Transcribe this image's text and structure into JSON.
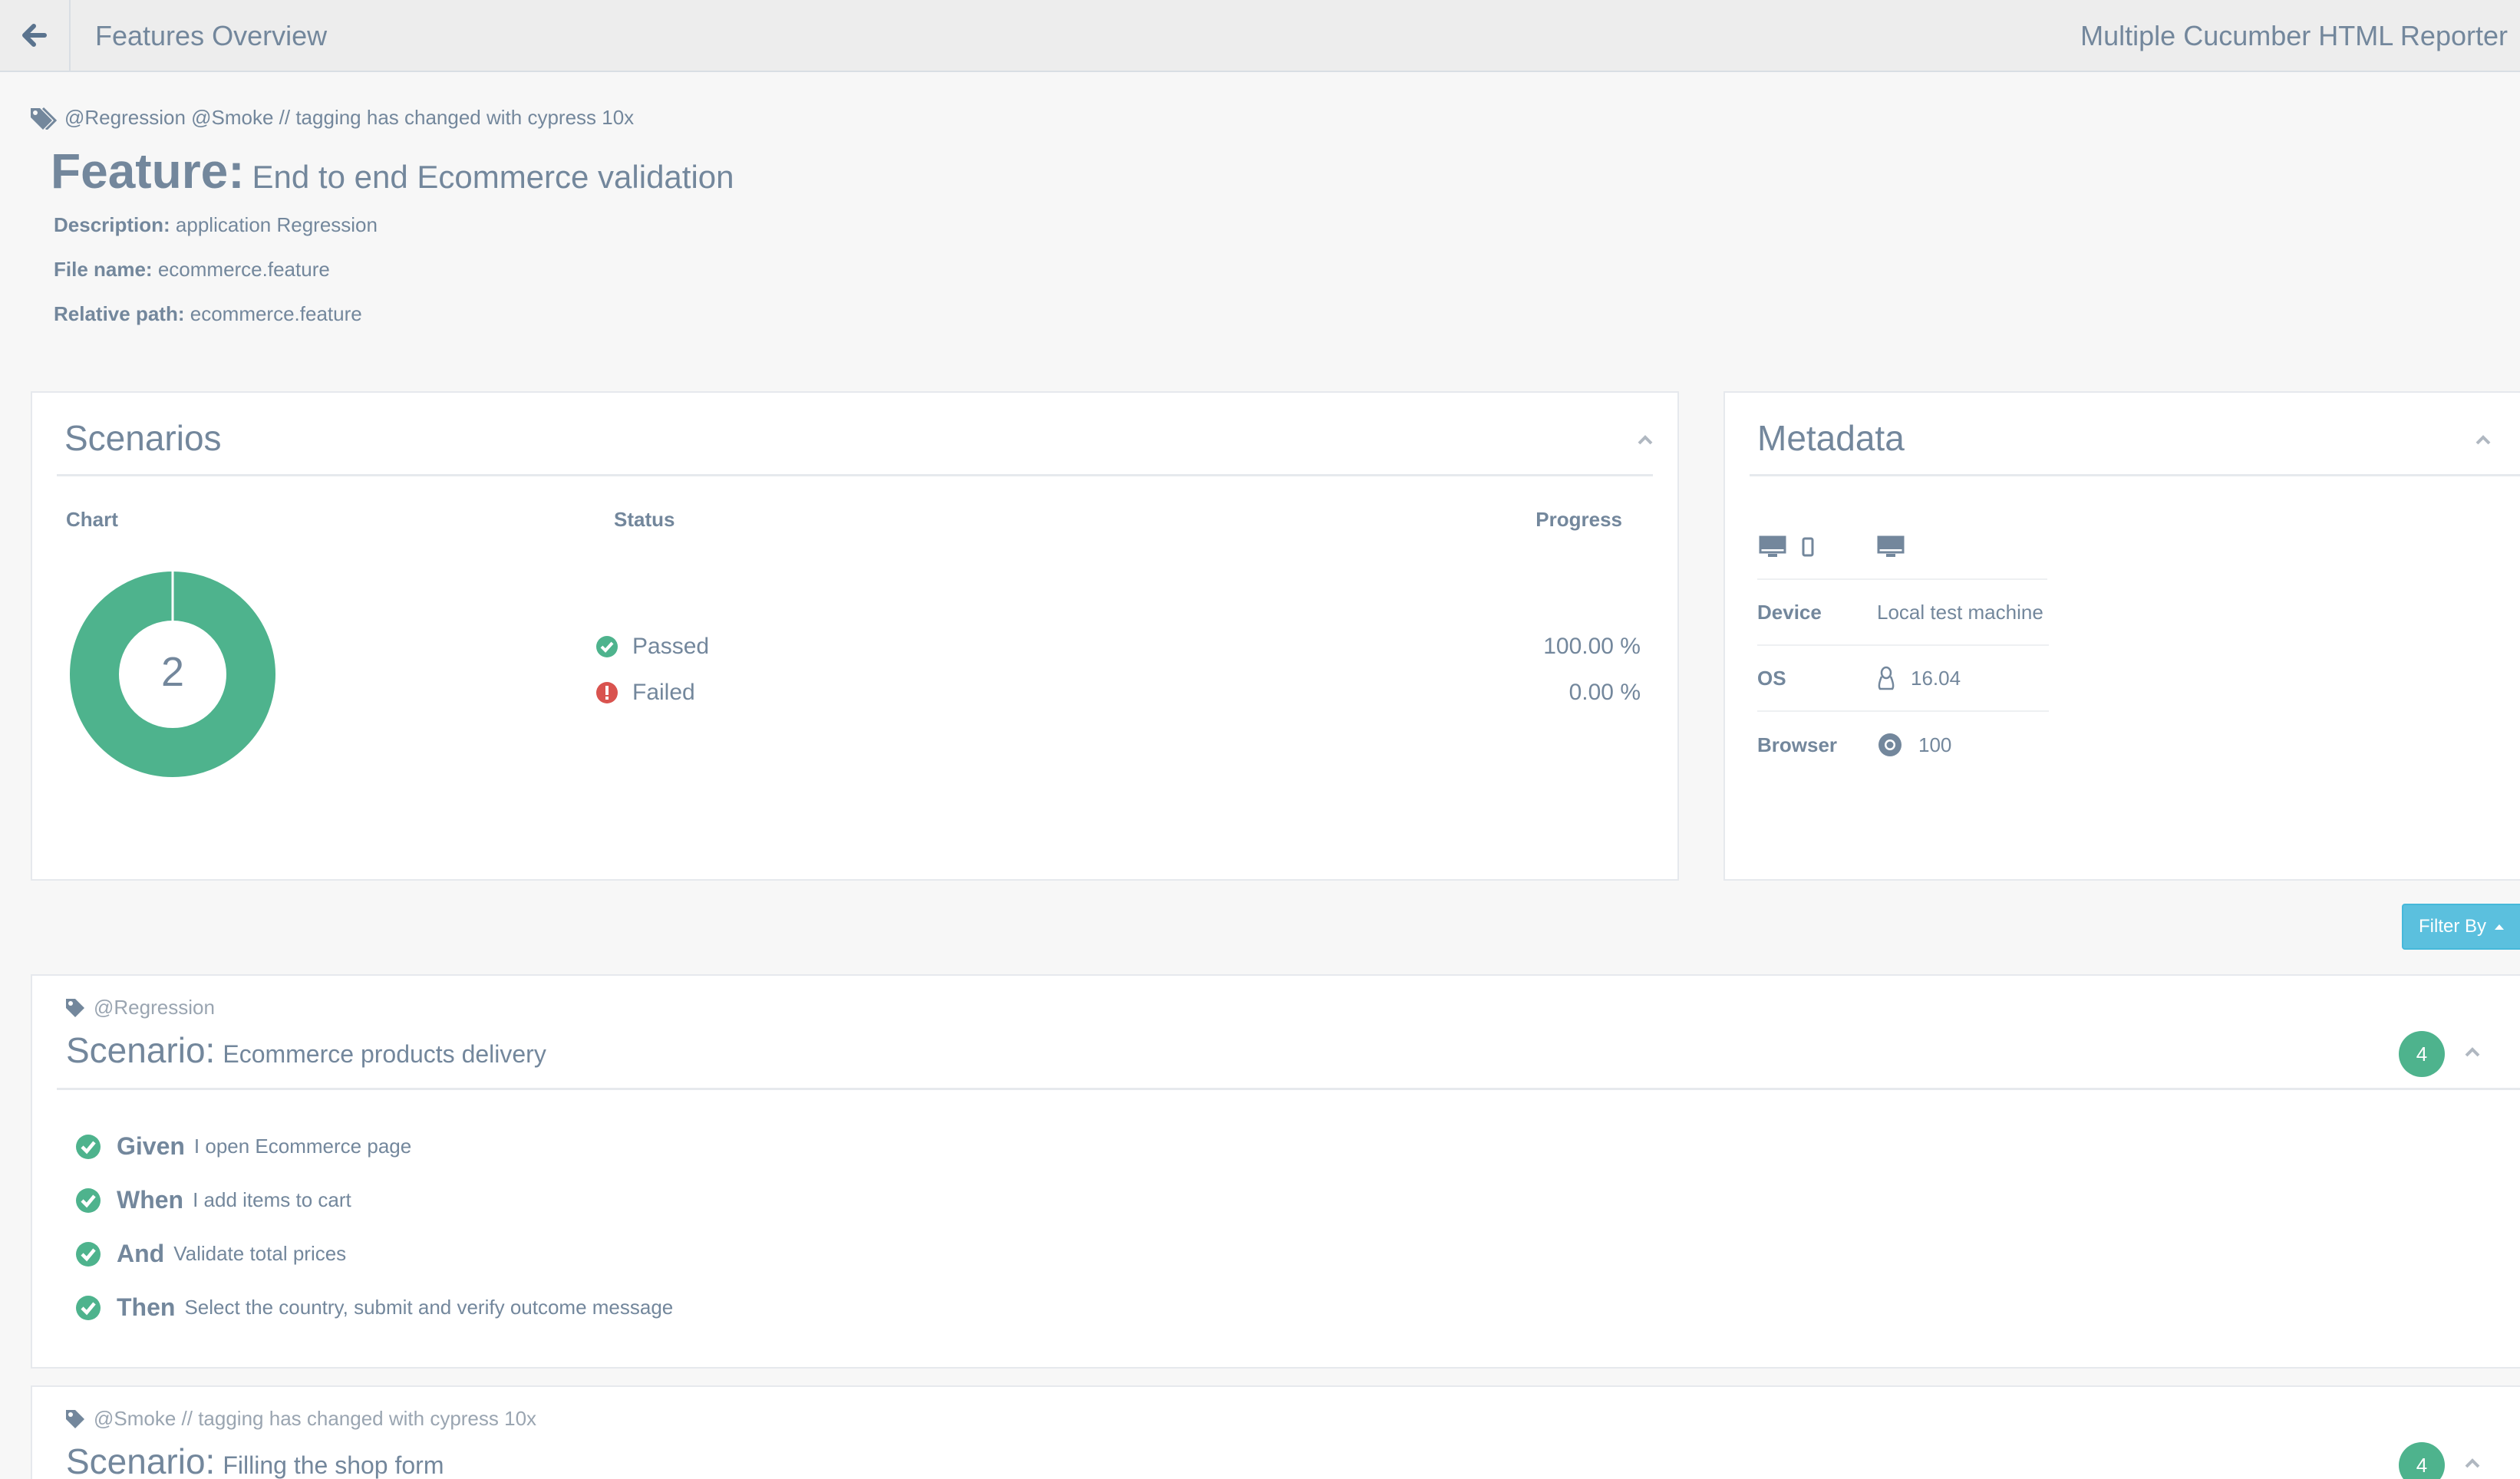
{
  "header": {
    "title": "Features Overview",
    "brand": "Multiple Cucumber HTML Reporter"
  },
  "feature": {
    "tags": "@Regression @Smoke // tagging has changed with cypress 10x",
    "keyword": "Feature:",
    "name": "End to end Ecommerce validation",
    "description_label": "Description:",
    "description": "application Regression",
    "filename_label": "File name:",
    "filename": "ecommerce.feature",
    "relpath_label": "Relative path:",
    "relpath": "ecommerce.feature"
  },
  "scenarios_panel": {
    "title": "Scenarios",
    "col_chart": "Chart",
    "col_status": "Status",
    "col_progress": "Progress",
    "total": "2",
    "statuses": [
      {
        "label": "Passed",
        "progress": "100.00 %"
      },
      {
        "label": "Failed",
        "progress": "0.00 %"
      }
    ]
  },
  "chart_data": {
    "type": "pie",
    "categories": [
      "Passed",
      "Failed"
    ],
    "values": [
      2,
      0
    ],
    "center_label": "2",
    "colors": [
      "#4eb38d",
      "#d9534f"
    ]
  },
  "metadata_panel": {
    "title": "Metadata",
    "icons": [
      "desktop-icon",
      "mobile-icon",
      "desktop-icon"
    ],
    "rows": [
      {
        "label": "Device",
        "value": "Local test machine"
      },
      {
        "label": "OS",
        "value": "16.04",
        "icon": "linux-icon"
      },
      {
        "label": "Browser",
        "value": "100",
        "icon": "chrome-icon"
      }
    ]
  },
  "filter": {
    "label": "Filter By"
  },
  "scenarios": [
    {
      "tags": "@Regression",
      "keyword": "Scenario:",
      "name": "Ecommerce products delivery",
      "step_count": "4",
      "steps": [
        {
          "keyword": "Given",
          "text": "I open Ecommerce page"
        },
        {
          "keyword": "When",
          "text": "I add items to cart"
        },
        {
          "keyword": "And",
          "text": "Validate total prices"
        },
        {
          "keyword": "Then",
          "text": "Select the country, submit and verify outcome message"
        }
      ]
    },
    {
      "tags": "@Smoke // tagging has changed with cypress 10x",
      "keyword": "Scenario:",
      "name": "Filling the shop form",
      "step_count": "4"
    }
  ],
  "colors": {
    "text": "#73879c",
    "passed": "#4eb38d",
    "failed": "#d9534f",
    "filter": "#5bc0de"
  }
}
